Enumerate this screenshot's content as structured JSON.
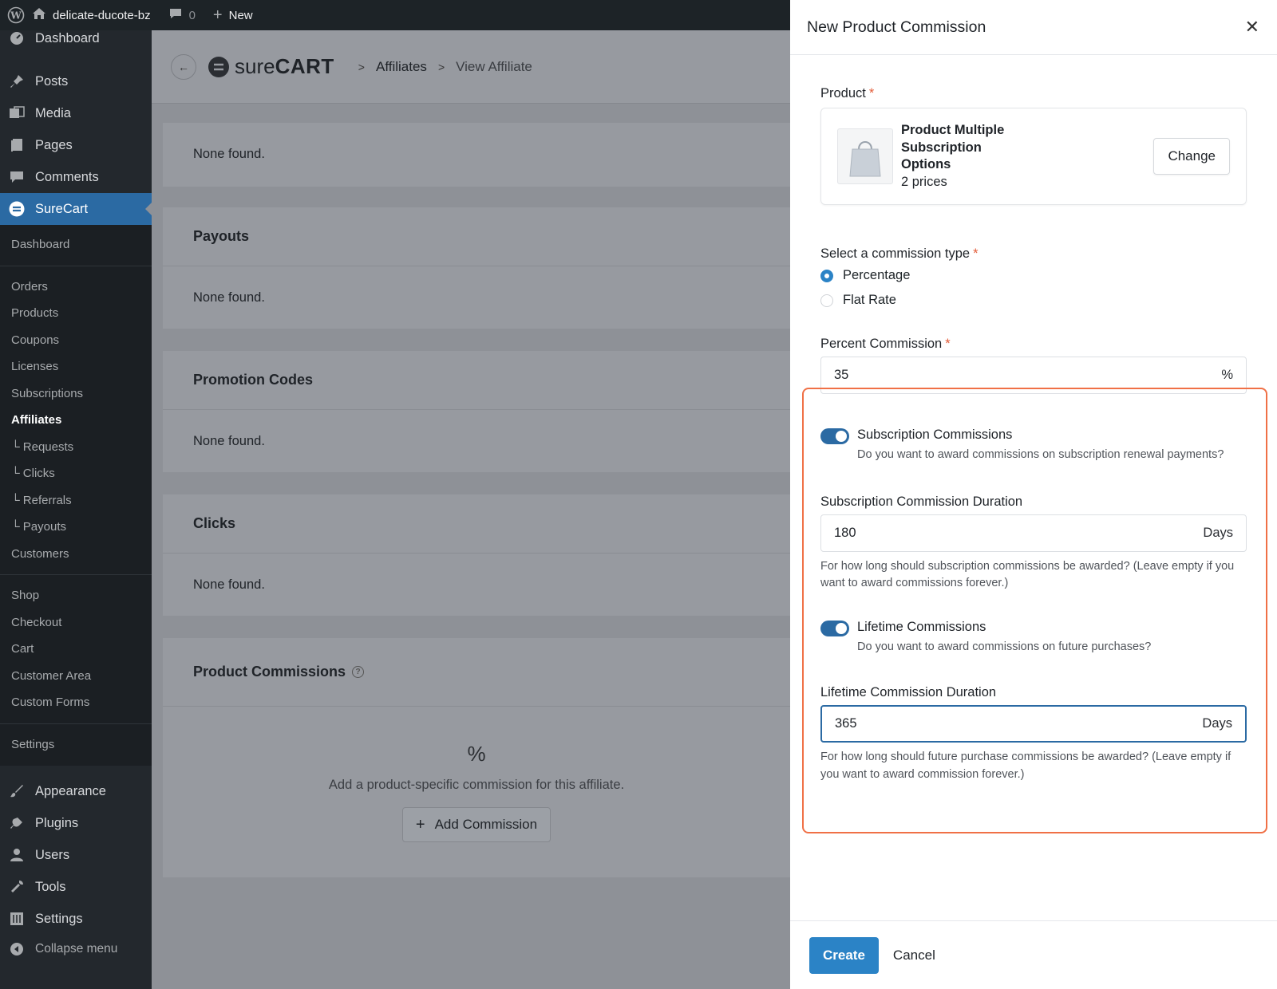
{
  "adminbar": {
    "site_name": "delicate-ducote-bz",
    "comments_count": "0",
    "new_label": "New"
  },
  "sidebar": {
    "top_items": [
      {
        "label": "Dashboard",
        "icon": "dashboard-icon"
      },
      {
        "label": "Posts",
        "icon": "pin-icon"
      },
      {
        "label": "Media",
        "icon": "media-icon"
      },
      {
        "label": "Pages",
        "icon": "pages-icon"
      },
      {
        "label": "Comments",
        "icon": "comment-icon"
      },
      {
        "label": "SureCart",
        "icon": "surecart-icon"
      }
    ],
    "surecart_sub": [
      "Dashboard",
      "Orders",
      "Products",
      "Coupons",
      "Licenses",
      "Subscriptions",
      "Affiliates",
      "└ Requests",
      "└ Clicks",
      "└ Referrals",
      "└ Payouts",
      "Customers",
      "Shop",
      "Checkout",
      "Cart",
      "Customer Area",
      "Custom Forms",
      "Settings"
    ],
    "bottom_items": [
      {
        "label": "Appearance",
        "icon": "brush-icon"
      },
      {
        "label": "Plugins",
        "icon": "plug-icon"
      },
      {
        "label": "Users",
        "icon": "user-icon"
      },
      {
        "label": "Tools",
        "icon": "wrench-icon"
      },
      {
        "label": "Settings",
        "icon": "settings-icon"
      },
      {
        "label": "Collapse menu",
        "icon": "collapse-icon"
      }
    ]
  },
  "breadcrumb": {
    "brand": "sure",
    "brand_bold": "CART",
    "affiliates": "Affiliates",
    "current": "View Affiliate"
  },
  "main": {
    "none_found": "None found.",
    "payouts": "Payouts",
    "promotion_codes": "Promotion Codes",
    "clicks": "Clicks",
    "product_commissions": "Product Commissions",
    "empty_icon": "%",
    "empty_text": "Add a product-specific commission for this affiliate.",
    "add_commission": "Add Commission"
  },
  "panel": {
    "title": "New Product Commission",
    "product_label": "Product",
    "product_name": "Product Multiple Subscription Options",
    "product_prices": "2 prices",
    "change_label": "Change",
    "commission_type_label": "Select a commission type",
    "option_percentage": "Percentage",
    "option_flat": "Flat Rate",
    "percent_label": "Percent Commission",
    "percent_value": "35",
    "percent_suffix": "%",
    "sub_toggle_title": "Subscription Commissions",
    "sub_toggle_desc": "Do you want to award commissions on subscription renewal payments?",
    "sub_duration_label": "Subscription Commission Duration",
    "sub_duration_value": "180",
    "days": "Days",
    "sub_duration_help": "For how long should subscription commissions be awarded? (Leave empty if you want to award commissions forever.)",
    "life_toggle_title": "Lifetime Commissions",
    "life_toggle_desc": "Do you want to award commissions on future purchases?",
    "life_duration_label": "Lifetime Commission Duration",
    "life_duration_value": "365",
    "life_duration_help": "For how long should future purchase commissions be awarded? (Leave empty if you want to award commission forever.)",
    "create_label": "Create",
    "cancel_label": "Cancel"
  },
  "colors": {
    "accent": "#2b83c6",
    "highlight": "#f07046",
    "required": "#e35d3a"
  }
}
